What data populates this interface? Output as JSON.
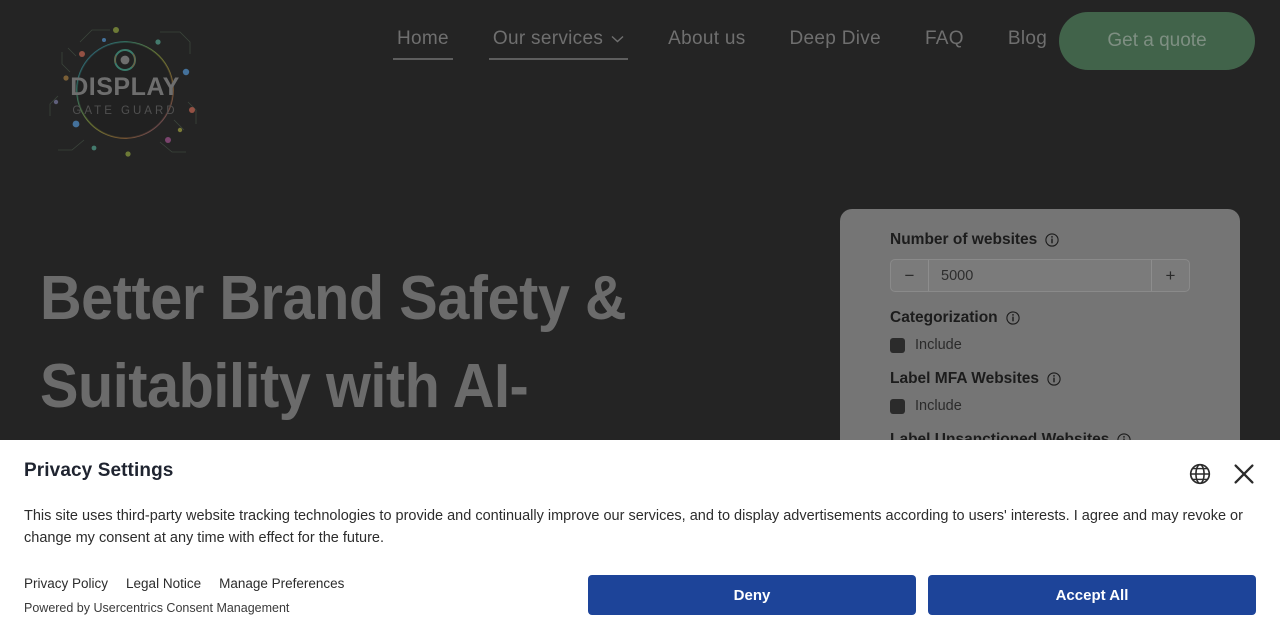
{
  "colors": {
    "page_bg": "#242424",
    "panel_bg": "#757575",
    "quote_button_bg": "#41634a",
    "banner_bg": "#ffffff",
    "banner_button_blue": "#1d4499",
    "nav_text": "#6f6f6f"
  },
  "header": {
    "logo": {
      "icon": "display-gate-guard-logo",
      "primary_text": "DISPLAY",
      "secondary_text": "GATE GUARD"
    },
    "nav_items": [
      {
        "label": "Home",
        "state": "active",
        "has_chevron": false
      },
      {
        "label": "Our services",
        "state": "open",
        "has_chevron": true,
        "chevron_icon": "chevron-down-icon"
      },
      {
        "label": "About us",
        "state": "default",
        "has_chevron": false
      },
      {
        "label": "Deep Dive",
        "state": "default",
        "has_chevron": false
      },
      {
        "label": "FAQ",
        "state": "default",
        "has_chevron": false
      },
      {
        "label": "Blog",
        "state": "default",
        "has_chevron": false
      }
    ],
    "cta": {
      "label": "Get a quote"
    }
  },
  "hero": {
    "title_line1": "Better Brand Safety &",
    "title_line2": "Suitability with AI-"
  },
  "config_panel": {
    "fields": [
      {
        "label": "Number of websites",
        "info_icon": "info-icon",
        "type": "stepper",
        "decrement_label": "−",
        "increment_label": "+",
        "value": "5000"
      },
      {
        "label": "Categorization",
        "info_icon": "info-icon",
        "type": "checkbox",
        "checkbox_label": "Include",
        "checked": true
      },
      {
        "label": "Label MFA Websites",
        "info_icon": "info-icon",
        "type": "checkbox",
        "checkbox_label": "Include",
        "checked": true
      },
      {
        "label": "Label Unsanctioned Websites",
        "info_icon": "info-icon",
        "type": "label-clipped"
      }
    ]
  },
  "privacy_banner": {
    "title": "Privacy Settings",
    "language_icon": "globe-icon",
    "close_icon": "close-icon",
    "body": "This site uses third-party website tracking technologies to provide and continually improve our services, and to display advertisements according to users' interests. I agree and may revoke or change my consent at any time with effect for the future.",
    "links": [
      {
        "label": "Privacy Policy"
      },
      {
        "label": "Legal Notice"
      },
      {
        "label": "Manage Preferences"
      }
    ],
    "powered_by": "Powered by Usercentrics Consent Management",
    "buttons": [
      {
        "label": "Deny"
      },
      {
        "label": "Accept All"
      }
    ]
  }
}
